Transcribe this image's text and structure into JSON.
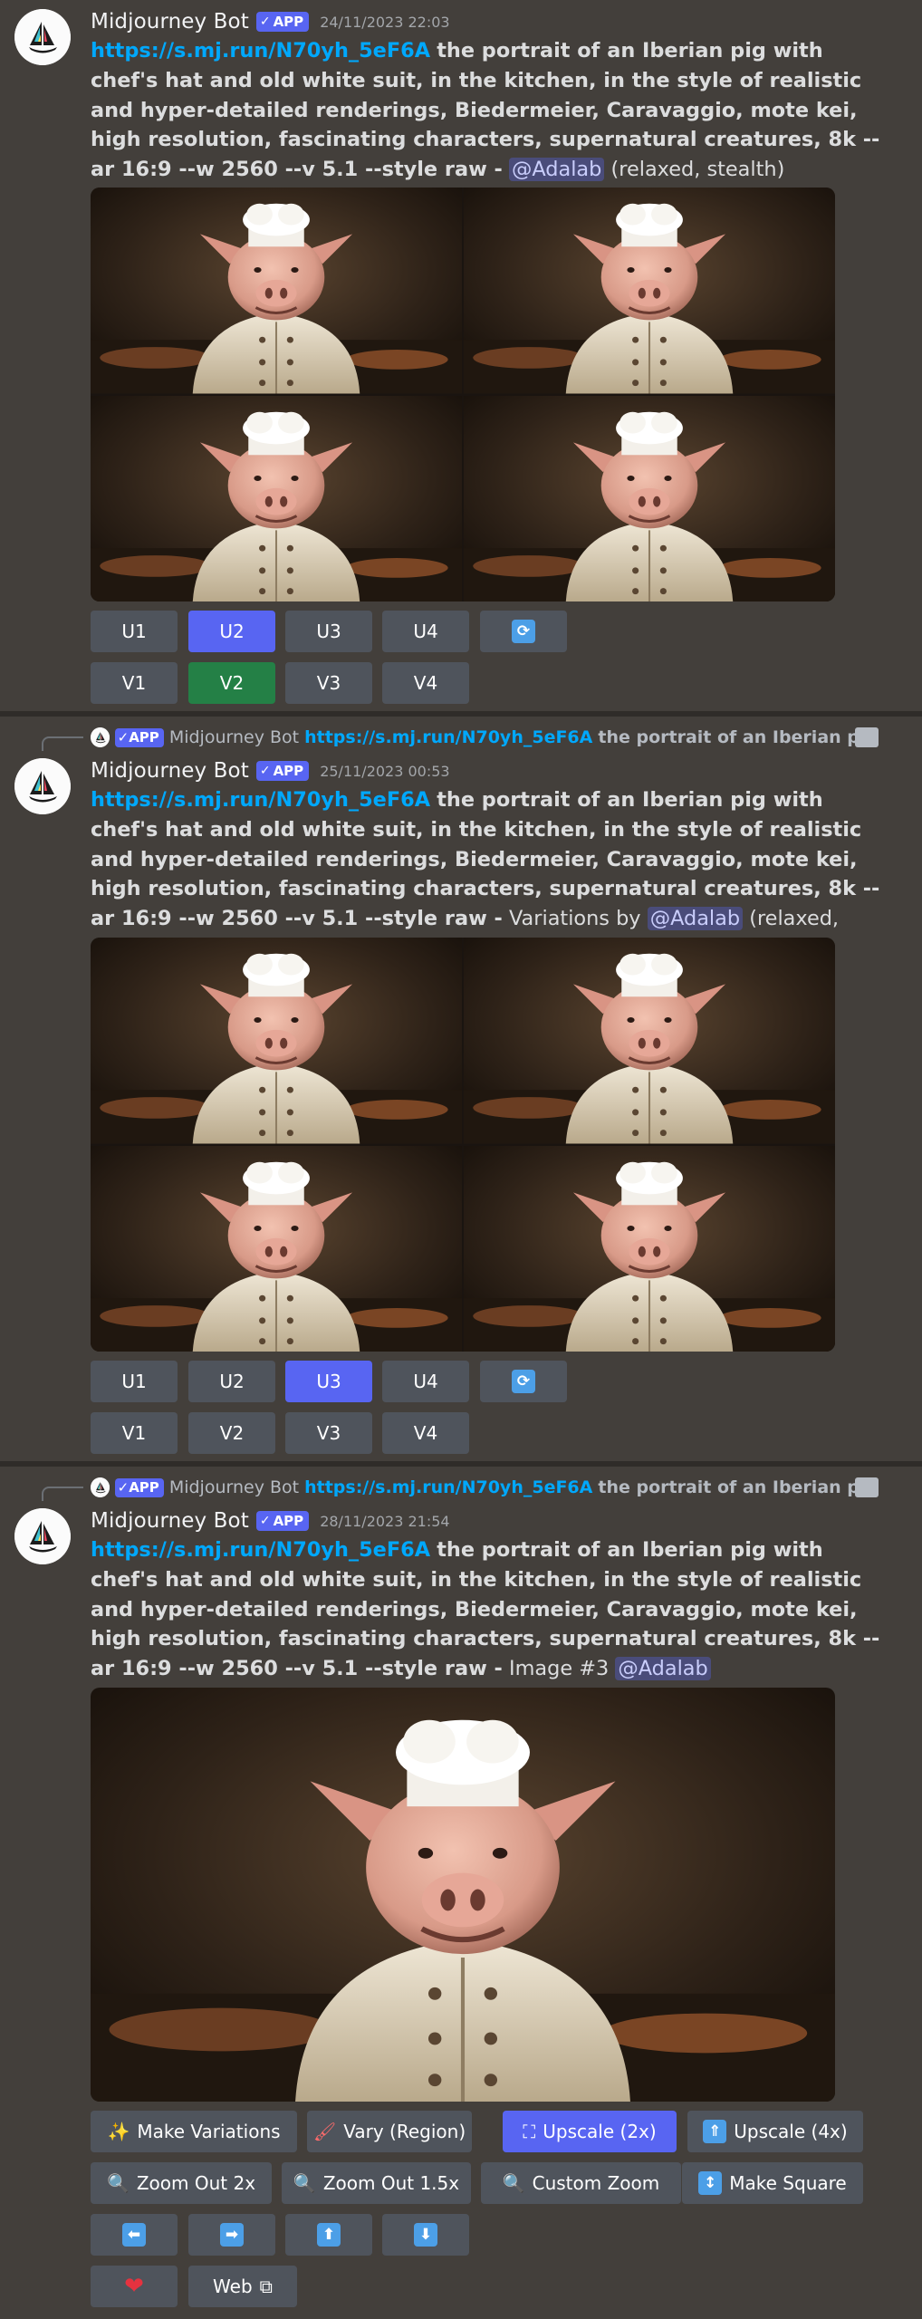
{
  "bot_name": "Midjourney Bot",
  "app_badge": "APP",
  "prompt_link": "https://s.mj.run/N70yh_5eF6A",
  "prompt_text": "the portrait of an Iberian pig with chef's hat and old white suit, in the kitchen, in the style of realistic and hyper-detailed renderings, Biedermeier, Caravaggio, mote kei, high resolution, fascinating characters, supernatural creatures, 8k --ar 16:9 --w 2560 --v 5.1 --style raw -",
  "reply_preview": "the portrait of an Iberian pig...",
  "user_mention": "@Adalab",
  "messages": [
    {
      "timestamp": "24/11/2023 22:03",
      "prefix": "",
      "suffix": "(relaxed, stealth)",
      "upscale_buttons": [
        "U1",
        "U2",
        "U3",
        "U4"
      ],
      "variation_buttons": [
        "V1",
        "V2",
        "V3",
        "V4"
      ]
    },
    {
      "timestamp": "25/11/2023 00:53",
      "prefix": "Variations by",
      "suffix": "(relaxed, stealth)",
      "upscale_buttons": [
        "U1",
        "U2",
        "U3",
        "U4"
      ],
      "variation_buttons": [
        "V1",
        "V2",
        "V3",
        "V4"
      ]
    },
    {
      "timestamp": "28/11/2023 21:54",
      "prefix": "Image #3",
      "suffix": "",
      "actions": {
        "make_variations": "Make Variations",
        "vary_region": "Vary (Region)",
        "upscale_2x": "Upscale (2x)",
        "upscale_4x": "Upscale (4x)",
        "zoom_out_2x": "Zoom Out 2x",
        "zoom_out_15x": "Zoom Out 1.5x",
        "custom_zoom": "Custom Zoom",
        "make_square": "Make Square",
        "web": "Web"
      }
    }
  ],
  "colors": {
    "link": "#00a8fc",
    "blurple": "#5865f2",
    "green": "#248046",
    "button_gray": "#4f545c"
  },
  "icons": [
    "refresh-icon",
    "sparkles-icon",
    "brush-icon",
    "expand-icon",
    "upload-icon",
    "magnifier-icon",
    "vertical-arrows-icon",
    "arrow-left-icon",
    "arrow-right-icon",
    "arrow-up-icon",
    "arrow-down-icon",
    "heart-icon",
    "external-link-icon",
    "image-icon"
  ]
}
